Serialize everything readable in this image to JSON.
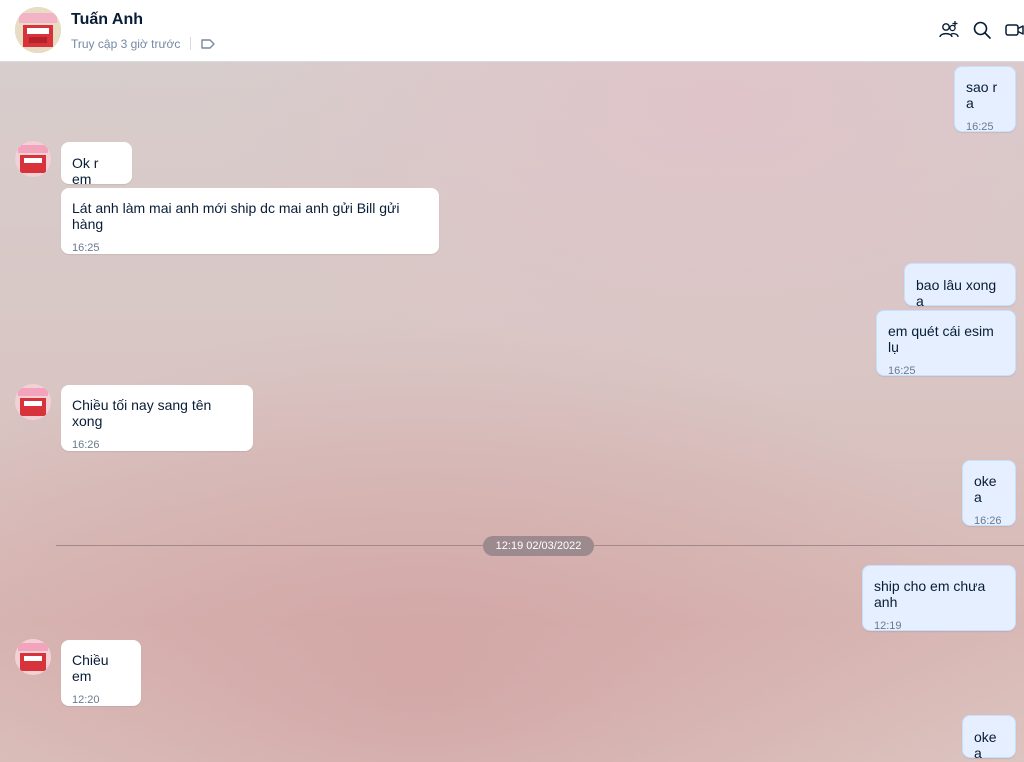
{
  "header": {
    "title": "Tuấn Anh",
    "subtitle": "Truy cập 3 giờ trước",
    "icons": [
      "add-user-group-icon",
      "search-icon",
      "video-call-icon",
      "tag-icon"
    ]
  },
  "divider": {
    "label": "12:19 02/03/2022"
  },
  "messages": [
    {
      "dir": "out",
      "text": "sao r a",
      "time": "16:25"
    },
    {
      "dir": "in",
      "text": "Ok r em",
      "time": ""
    },
    {
      "dir": "in",
      "text": "Lát anh làm mai anh mới ship dc mai anh gửi Bill gửi hàng",
      "time": "16:25"
    },
    {
      "dir": "out",
      "text": "bao lâu xong a",
      "time": ""
    },
    {
      "dir": "out",
      "text": "em quét cái esim lụ",
      "time": "16:25"
    },
    {
      "dir": "in",
      "text": "Chiều tối nay sang tên xong",
      "time": "16:26"
    },
    {
      "dir": "out",
      "text": "oke a",
      "time": "16:26"
    },
    {
      "dir": "out",
      "text": "ship cho em chưa anh",
      "time": "12:19"
    },
    {
      "dir": "in",
      "text": "Chiều em",
      "time": "12:20"
    },
    {
      "dir": "out",
      "text": "oke a",
      "time": ""
    }
  ],
  "colors": {
    "header_bg": "#ffffff",
    "incoming_bubble": "#ffffff",
    "outgoing_bubble": "#e5efff",
    "accent_text": "#081c36"
  }
}
